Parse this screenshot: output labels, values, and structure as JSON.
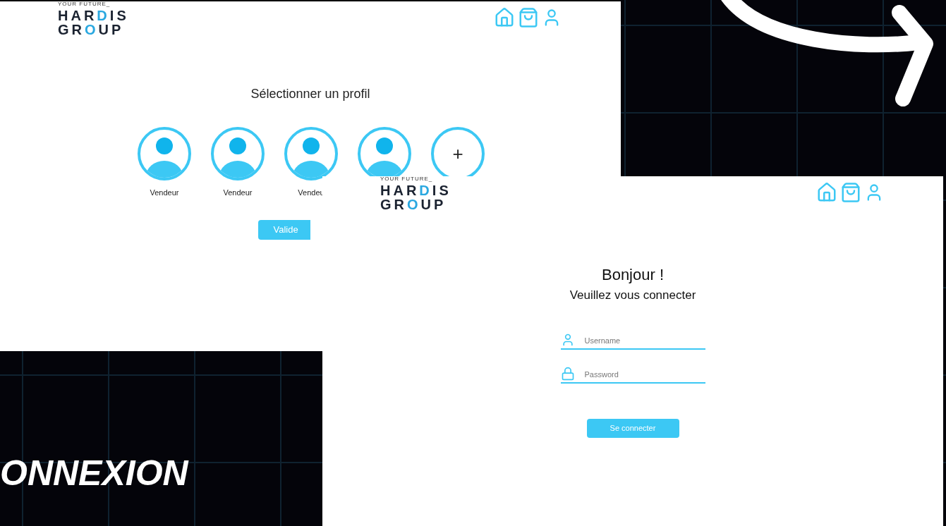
{
  "profile_screen": {
    "logo": {
      "tagline": "YOUR FUTURE_",
      "line1": "HARDIS",
      "line2": "GROUP"
    },
    "title": "Sélectionner un profil",
    "profiles": [
      {
        "kind": "avatar",
        "label": "Vendeur"
      },
      {
        "kind": "avatar",
        "label": "Vendeur"
      },
      {
        "kind": "avatar",
        "label": "Vendeu"
      },
      {
        "kind": "avatar"
      },
      {
        "kind": "add",
        "symbol": "+"
      }
    ],
    "button": "Valide"
  },
  "login_screen": {
    "logo": {
      "tagline": "YOUR FUTURE_",
      "line1": "HARDIS",
      "line2": "GROUP"
    },
    "greeting": "Bonjour !",
    "subtitle": "Veuillez vous connecter",
    "fields": [
      {
        "kind": "user",
        "placeholder": "Username"
      },
      {
        "kind": "lock",
        "placeholder": "Password"
      }
    ],
    "button": "Se connecter"
  },
  "caption": "ONNEXION"
}
